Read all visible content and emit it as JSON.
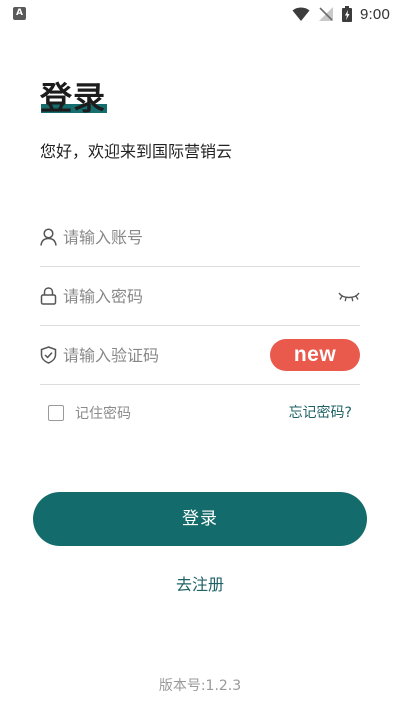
{
  "status_bar": {
    "notification_icon": "A",
    "time": "9:00"
  },
  "header": {
    "title": "登录",
    "subtitle": "您好，欢迎来到国际营销云"
  },
  "form": {
    "account": {
      "placeholder": "请输入账号",
      "value": ""
    },
    "password": {
      "placeholder": "请输入密码",
      "value": ""
    },
    "captcha": {
      "placeholder": "请输入验证码",
      "value": "",
      "badge_label": "new"
    },
    "remember": {
      "label": "记住密码",
      "checked": false
    },
    "forgot_label": "忘记密码?"
  },
  "actions": {
    "login_label": "登录",
    "register_label": "去注册"
  },
  "footer": {
    "version": "版本号:1.2.3"
  },
  "colors": {
    "primary": "#136c6b",
    "link": "#1f6266",
    "badge": "#e95a4d"
  },
  "icons": {
    "account": "user-icon",
    "password": "lock-icon",
    "captcha": "shield-check-icon",
    "visibility": "eye-closed-icon"
  }
}
